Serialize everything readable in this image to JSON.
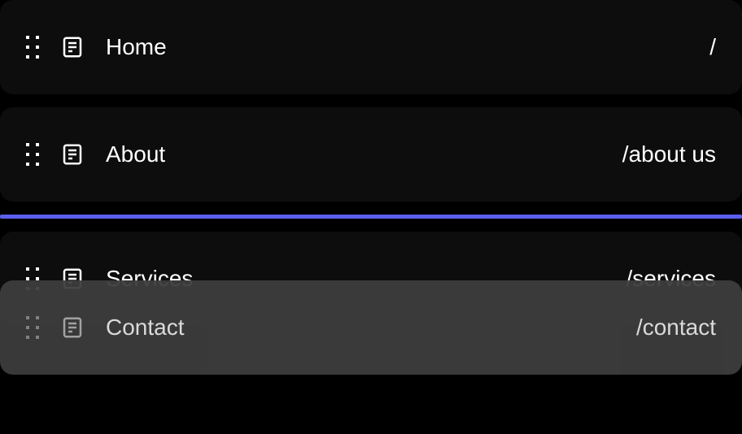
{
  "items": [
    {
      "title": "Home",
      "path": "/"
    },
    {
      "title": "About",
      "path": "/about us"
    },
    {
      "title": "Services",
      "path": "/services"
    },
    {
      "title": "Contact",
      "path": "/contact"
    }
  ],
  "drop_indicator_color": "#5b5fef"
}
